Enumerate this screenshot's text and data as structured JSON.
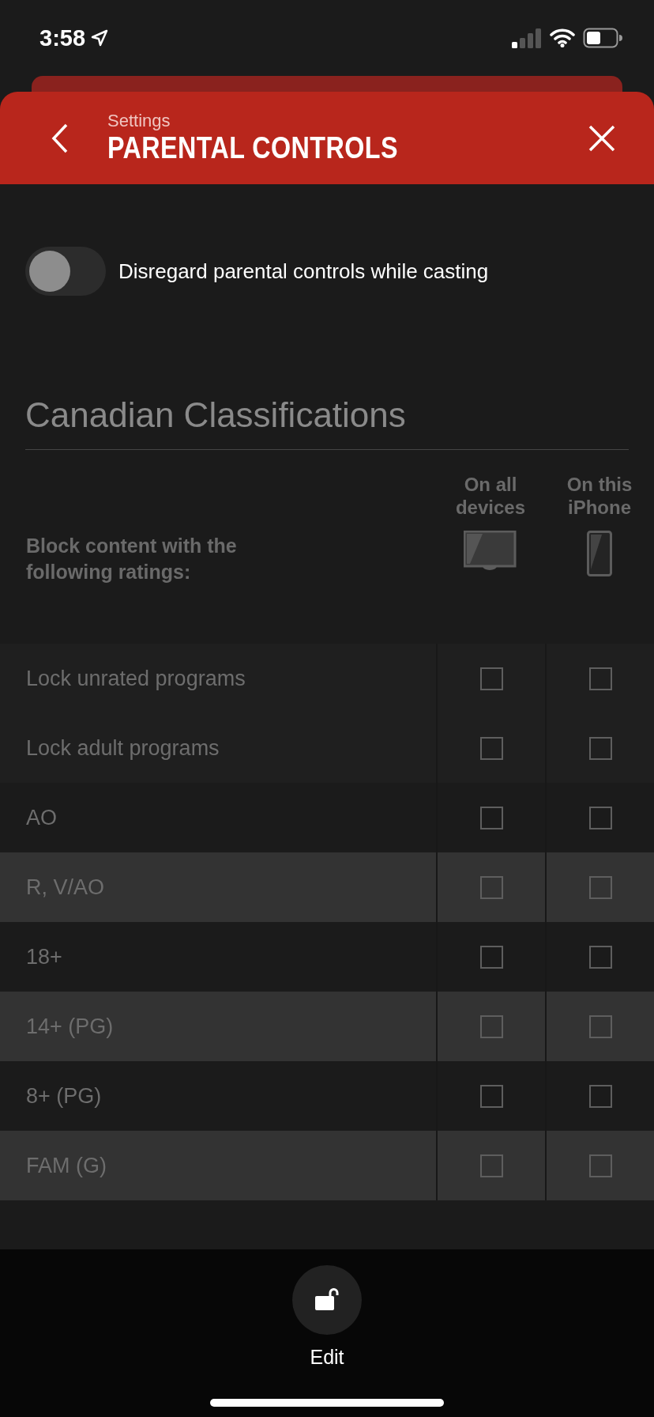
{
  "status_bar": {
    "time": "3:58"
  },
  "header": {
    "subtitle": "Settings",
    "title": "PARENTAL CONTROLS"
  },
  "cast_toggle": {
    "label": "Disregard parental controls while casting",
    "on": false
  },
  "section": {
    "title": "Canadian Classifications"
  },
  "table": {
    "caption": "Block content with the following ratings:",
    "columns": [
      {
        "label": "On all devices",
        "kind": "tv"
      },
      {
        "label": "On this iPhone",
        "kind": "phone"
      }
    ],
    "rows": [
      {
        "kind": "lock",
        "label": "Lock unrated programs",
        "all_devices": false,
        "this_iphone": false
      },
      {
        "kind": "lock",
        "label": "Lock adult programs",
        "all_devices": false,
        "this_iphone": false
      },
      {
        "kind": "rating",
        "label": "AO",
        "all_devices": false,
        "this_iphone": false
      },
      {
        "kind": "rating",
        "label": "R, V/AO",
        "all_devices": false,
        "this_iphone": false
      },
      {
        "kind": "rating",
        "label": "18+",
        "all_devices": false,
        "this_iphone": false
      },
      {
        "kind": "rating",
        "label": "14+ (PG)",
        "all_devices": false,
        "this_iphone": false
      },
      {
        "kind": "rating",
        "label": "8+ (PG)",
        "all_devices": false,
        "this_iphone": false
      },
      {
        "kind": "rating",
        "label": "FAM (G)",
        "all_devices": false,
        "this_iphone": false
      }
    ]
  },
  "edit_button": {
    "label": "Edit"
  }
}
